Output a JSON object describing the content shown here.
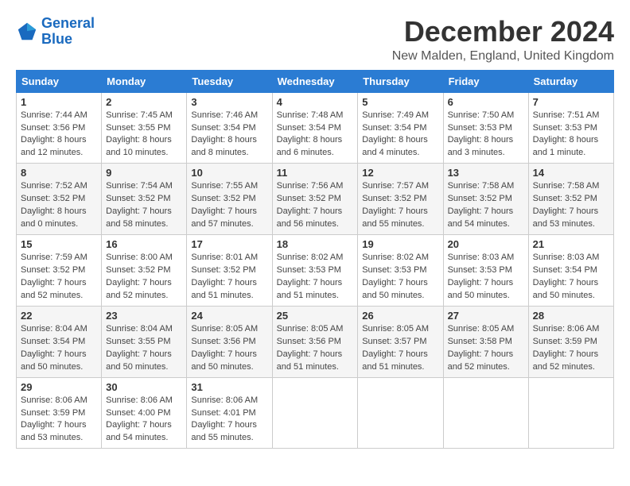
{
  "logo": {
    "line1": "General",
    "line2": "Blue"
  },
  "title": "December 2024",
  "location": "New Malden, England, United Kingdom",
  "days_of_week": [
    "Sunday",
    "Monday",
    "Tuesday",
    "Wednesday",
    "Thursday",
    "Friday",
    "Saturday"
  ],
  "weeks": [
    [
      {
        "day": "1",
        "sunrise": "Sunrise: 7:44 AM",
        "sunset": "Sunset: 3:56 PM",
        "daylight": "Daylight: 8 hours and 12 minutes."
      },
      {
        "day": "2",
        "sunrise": "Sunrise: 7:45 AM",
        "sunset": "Sunset: 3:55 PM",
        "daylight": "Daylight: 8 hours and 10 minutes."
      },
      {
        "day": "3",
        "sunrise": "Sunrise: 7:46 AM",
        "sunset": "Sunset: 3:54 PM",
        "daylight": "Daylight: 8 hours and 8 minutes."
      },
      {
        "day": "4",
        "sunrise": "Sunrise: 7:48 AM",
        "sunset": "Sunset: 3:54 PM",
        "daylight": "Daylight: 8 hours and 6 minutes."
      },
      {
        "day": "5",
        "sunrise": "Sunrise: 7:49 AM",
        "sunset": "Sunset: 3:54 PM",
        "daylight": "Daylight: 8 hours and 4 minutes."
      },
      {
        "day": "6",
        "sunrise": "Sunrise: 7:50 AM",
        "sunset": "Sunset: 3:53 PM",
        "daylight": "Daylight: 8 hours and 3 minutes."
      },
      {
        "day": "7",
        "sunrise": "Sunrise: 7:51 AM",
        "sunset": "Sunset: 3:53 PM",
        "daylight": "Daylight: 8 hours and 1 minute."
      }
    ],
    [
      {
        "day": "8",
        "sunrise": "Sunrise: 7:52 AM",
        "sunset": "Sunset: 3:52 PM",
        "daylight": "Daylight: 8 hours and 0 minutes."
      },
      {
        "day": "9",
        "sunrise": "Sunrise: 7:54 AM",
        "sunset": "Sunset: 3:52 PM",
        "daylight": "Daylight: 7 hours and 58 minutes."
      },
      {
        "day": "10",
        "sunrise": "Sunrise: 7:55 AM",
        "sunset": "Sunset: 3:52 PM",
        "daylight": "Daylight: 7 hours and 57 minutes."
      },
      {
        "day": "11",
        "sunrise": "Sunrise: 7:56 AM",
        "sunset": "Sunset: 3:52 PM",
        "daylight": "Daylight: 7 hours and 56 minutes."
      },
      {
        "day": "12",
        "sunrise": "Sunrise: 7:57 AM",
        "sunset": "Sunset: 3:52 PM",
        "daylight": "Daylight: 7 hours and 55 minutes."
      },
      {
        "day": "13",
        "sunrise": "Sunrise: 7:58 AM",
        "sunset": "Sunset: 3:52 PM",
        "daylight": "Daylight: 7 hours and 54 minutes."
      },
      {
        "day": "14",
        "sunrise": "Sunrise: 7:58 AM",
        "sunset": "Sunset: 3:52 PM",
        "daylight": "Daylight: 7 hours and 53 minutes."
      }
    ],
    [
      {
        "day": "15",
        "sunrise": "Sunrise: 7:59 AM",
        "sunset": "Sunset: 3:52 PM",
        "daylight": "Daylight: 7 hours and 52 minutes."
      },
      {
        "day": "16",
        "sunrise": "Sunrise: 8:00 AM",
        "sunset": "Sunset: 3:52 PM",
        "daylight": "Daylight: 7 hours and 52 minutes."
      },
      {
        "day": "17",
        "sunrise": "Sunrise: 8:01 AM",
        "sunset": "Sunset: 3:52 PM",
        "daylight": "Daylight: 7 hours and 51 minutes."
      },
      {
        "day": "18",
        "sunrise": "Sunrise: 8:02 AM",
        "sunset": "Sunset: 3:53 PM",
        "daylight": "Daylight: 7 hours and 51 minutes."
      },
      {
        "day": "19",
        "sunrise": "Sunrise: 8:02 AM",
        "sunset": "Sunset: 3:53 PM",
        "daylight": "Daylight: 7 hours and 50 minutes."
      },
      {
        "day": "20",
        "sunrise": "Sunrise: 8:03 AM",
        "sunset": "Sunset: 3:53 PM",
        "daylight": "Daylight: 7 hours and 50 minutes."
      },
      {
        "day": "21",
        "sunrise": "Sunrise: 8:03 AM",
        "sunset": "Sunset: 3:54 PM",
        "daylight": "Daylight: 7 hours and 50 minutes."
      }
    ],
    [
      {
        "day": "22",
        "sunrise": "Sunrise: 8:04 AM",
        "sunset": "Sunset: 3:54 PM",
        "daylight": "Daylight: 7 hours and 50 minutes."
      },
      {
        "day": "23",
        "sunrise": "Sunrise: 8:04 AM",
        "sunset": "Sunset: 3:55 PM",
        "daylight": "Daylight: 7 hours and 50 minutes."
      },
      {
        "day": "24",
        "sunrise": "Sunrise: 8:05 AM",
        "sunset": "Sunset: 3:56 PM",
        "daylight": "Daylight: 7 hours and 50 minutes."
      },
      {
        "day": "25",
        "sunrise": "Sunrise: 8:05 AM",
        "sunset": "Sunset: 3:56 PM",
        "daylight": "Daylight: 7 hours and 51 minutes."
      },
      {
        "day": "26",
        "sunrise": "Sunrise: 8:05 AM",
        "sunset": "Sunset: 3:57 PM",
        "daylight": "Daylight: 7 hours and 51 minutes."
      },
      {
        "day": "27",
        "sunrise": "Sunrise: 8:05 AM",
        "sunset": "Sunset: 3:58 PM",
        "daylight": "Daylight: 7 hours and 52 minutes."
      },
      {
        "day": "28",
        "sunrise": "Sunrise: 8:06 AM",
        "sunset": "Sunset: 3:59 PM",
        "daylight": "Daylight: 7 hours and 52 minutes."
      }
    ],
    [
      {
        "day": "29",
        "sunrise": "Sunrise: 8:06 AM",
        "sunset": "Sunset: 3:59 PM",
        "daylight": "Daylight: 7 hours and 53 minutes."
      },
      {
        "day": "30",
        "sunrise": "Sunrise: 8:06 AM",
        "sunset": "Sunset: 4:00 PM",
        "daylight": "Daylight: 7 hours and 54 minutes."
      },
      {
        "day": "31",
        "sunrise": "Sunrise: 8:06 AM",
        "sunset": "Sunset: 4:01 PM",
        "daylight": "Daylight: 7 hours and 55 minutes."
      },
      null,
      null,
      null,
      null
    ]
  ]
}
